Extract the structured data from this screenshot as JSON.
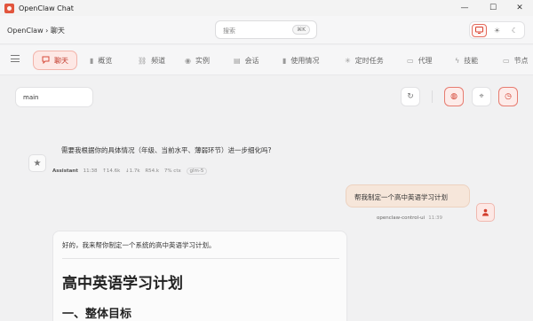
{
  "window": {
    "title": "OpenClaw Chat",
    "controls": {
      "minimize": "—",
      "maximize": "☐",
      "close": "✕"
    }
  },
  "header": {
    "breadcrumb": "OpenClaw › 聊天",
    "search": {
      "placeholder": "搜索",
      "shortcut": "⌘K"
    },
    "theme_icons": [
      "monitor-icon",
      "sun-icon",
      "moon-icon"
    ]
  },
  "nav": {
    "tabs": [
      {
        "label": "聊天",
        "icon": "chat-icon",
        "glyph": "💬",
        "active": true
      },
      {
        "label": "概览",
        "icon": "bar-chart-icon",
        "glyph": "▮"
      },
      {
        "label": "频道",
        "icon": "link-icon",
        "glyph": "⛓"
      },
      {
        "label": "实例",
        "icon": "radio-icon",
        "glyph": "◉"
      },
      {
        "label": "会话",
        "icon": "document-icon",
        "glyph": "▤"
      },
      {
        "label": "使用情况",
        "icon": "usage-icon",
        "glyph": "▮"
      },
      {
        "label": "定时任务",
        "icon": "loader-icon",
        "glyph": "✳"
      },
      {
        "label": "代理",
        "icon": "folder-icon",
        "glyph": "▭"
      },
      {
        "label": "技能",
        "icon": "bolt-icon",
        "glyph": "⚡"
      },
      {
        "label": "节点",
        "icon": "monitor-icon",
        "glyph": "▭"
      }
    ]
  },
  "toolbar": {
    "session": "main",
    "refresh_icon": "↻",
    "brain_icon": "◍",
    "focus_icon": "⌖",
    "clock_icon": "◷"
  },
  "messages": {
    "assistant_question": "需要我根据你的具体情况（年级、当前水平、薄弱环节）进一步细化吗?",
    "assistant_meta": {
      "sender": "Assistant",
      "time": "11:38",
      "tokens_up": "↑14.6k",
      "tokens_down": "↓1.7k",
      "cache": "R54.k",
      "ctx": "7% ctx",
      "model": "glm-5"
    },
    "user_message": "帮我制定一个高中英语学习计划",
    "user_meta": {
      "sender": "openclaw-control-ui",
      "time": "11:39"
    },
    "assistant_reply": {
      "intro": "好的，我来帮你制定一个系统的高中英语学习计划。",
      "h1": "高中英语学习计划",
      "h2": "一、整体目标"
    }
  }
}
